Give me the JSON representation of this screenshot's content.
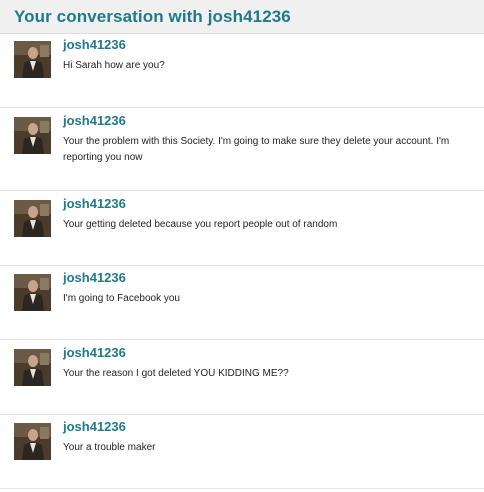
{
  "header": {
    "title": "Your conversation with josh41236"
  },
  "messages": [
    {
      "sender": "josh41236",
      "text": "Hi Sarah how are you?",
      "avatar_icon": "user-avatar-icon"
    },
    {
      "sender": "josh41236",
      "text": "Your the problem with this Society. I'm going to make sure they delete your account. I'm reporting you now",
      "avatar_icon": "user-avatar-icon"
    },
    {
      "sender": "josh41236",
      "text": "Your getting deleted because you report people out of random",
      "avatar_icon": "user-avatar-icon"
    },
    {
      "sender": "josh41236",
      "text": "I'm going to Facebook you",
      "avatar_icon": "user-avatar-icon"
    },
    {
      "sender": "josh41236",
      "text": "Your the reason I got deleted YOU KIDDING ME??",
      "avatar_icon": "user-avatar-icon"
    },
    {
      "sender": "josh41236",
      "text": "Your a trouble maker",
      "avatar_icon": "user-avatar-icon"
    }
  ],
  "colors": {
    "accent": "#1f7a8c",
    "header_bg": "#f0f0f0",
    "text": "#222222",
    "divider": "#e3e3e3"
  }
}
